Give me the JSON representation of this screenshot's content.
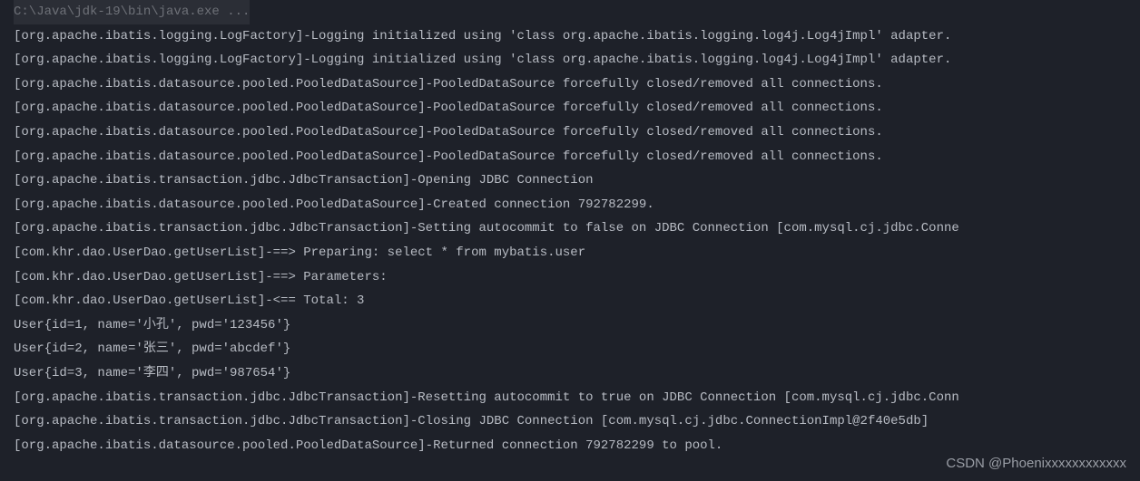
{
  "console": {
    "header": "C:\\Java\\jdk-19\\bin\\java.exe ...",
    "lines": [
      "[org.apache.ibatis.logging.LogFactory]-Logging initialized using 'class org.apache.ibatis.logging.log4j.Log4jImpl' adapter.",
      "[org.apache.ibatis.logging.LogFactory]-Logging initialized using 'class org.apache.ibatis.logging.log4j.Log4jImpl' adapter.",
      "[org.apache.ibatis.datasource.pooled.PooledDataSource]-PooledDataSource forcefully closed/removed all connections.",
      "[org.apache.ibatis.datasource.pooled.PooledDataSource]-PooledDataSource forcefully closed/removed all connections.",
      "[org.apache.ibatis.datasource.pooled.PooledDataSource]-PooledDataSource forcefully closed/removed all connections.",
      "[org.apache.ibatis.datasource.pooled.PooledDataSource]-PooledDataSource forcefully closed/removed all connections.",
      "[org.apache.ibatis.transaction.jdbc.JdbcTransaction]-Opening JDBC Connection",
      "[org.apache.ibatis.datasource.pooled.PooledDataSource]-Created connection 792782299.",
      "[org.apache.ibatis.transaction.jdbc.JdbcTransaction]-Setting autocommit to false on JDBC Connection [com.mysql.cj.jdbc.Conne",
      "[com.khr.dao.UserDao.getUserList]-==>  Preparing: select * from mybatis.user",
      "[com.khr.dao.UserDao.getUserList]-==> Parameters:",
      "[com.khr.dao.UserDao.getUserList]-<==      Total: 3",
      "User{id=1, name='小孔', pwd='123456'}",
      "User{id=2, name='张三', pwd='abcdef'}",
      "User{id=3, name='李四', pwd='987654'}",
      "[org.apache.ibatis.transaction.jdbc.JdbcTransaction]-Resetting autocommit to true on JDBC Connection [com.mysql.cj.jdbc.Conn",
      "[org.apache.ibatis.transaction.jdbc.JdbcTransaction]-Closing JDBC Connection [com.mysql.cj.jdbc.ConnectionImpl@2f40e5db]",
      "[org.apache.ibatis.datasource.pooled.PooledDataSource]-Returned connection 792782299 to pool."
    ]
  },
  "watermark": "CSDN @Phoenixxxxxxxxxxxx"
}
